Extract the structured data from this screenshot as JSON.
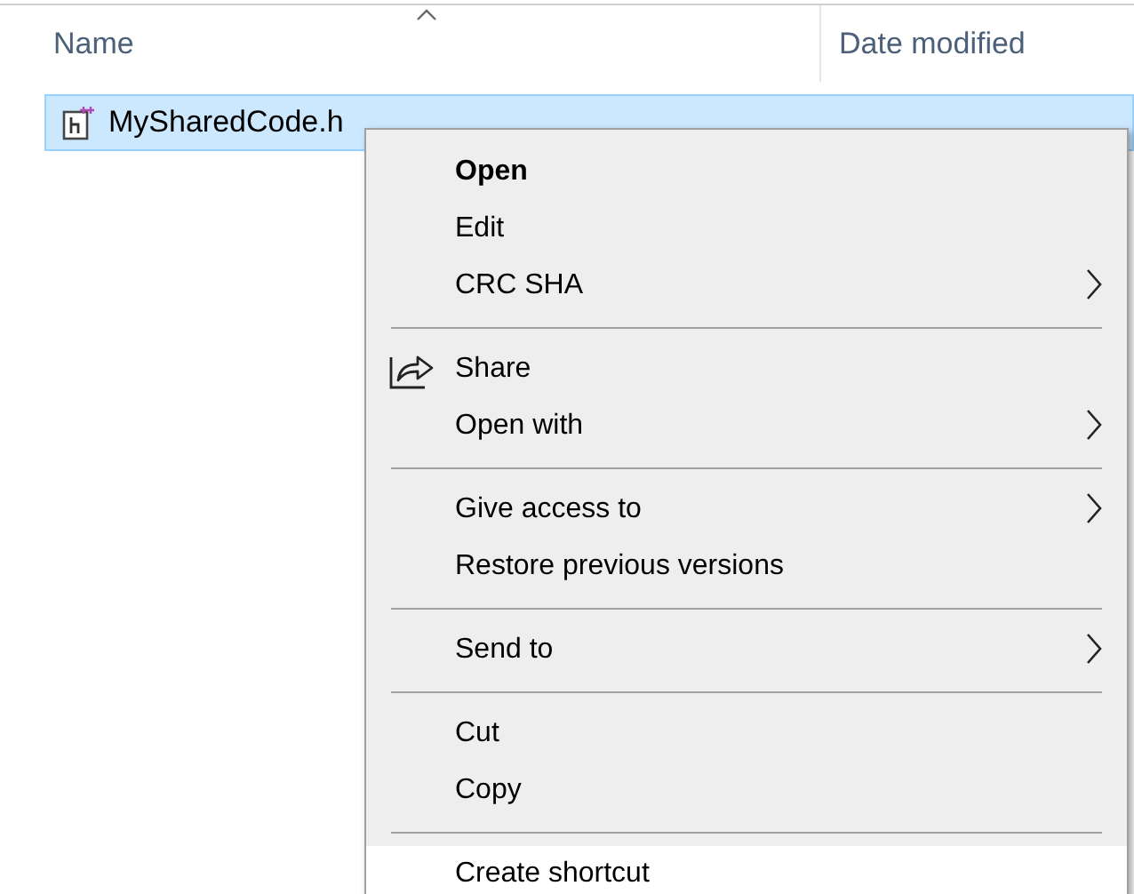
{
  "columns": [
    {
      "label": "Name",
      "sorted": true
    },
    {
      "label": "Date modified",
      "sorted": false
    }
  ],
  "files": [
    {
      "name": "MySharedCode.h",
      "selected": true
    }
  ],
  "context_menu": {
    "items": [
      {
        "kind": "item",
        "label": "Open",
        "default": true,
        "submenu": false,
        "has_icon": false,
        "highlighted": false
      },
      {
        "kind": "item",
        "label": "Edit",
        "default": false,
        "submenu": false,
        "has_icon": false,
        "highlighted": false
      },
      {
        "kind": "item",
        "label": "CRC SHA",
        "default": false,
        "submenu": true,
        "has_icon": false,
        "highlighted": false
      },
      {
        "kind": "separator"
      },
      {
        "kind": "item",
        "label": "Share",
        "default": false,
        "submenu": false,
        "has_icon": true,
        "highlighted": false
      },
      {
        "kind": "item",
        "label": "Open with",
        "default": false,
        "submenu": true,
        "has_icon": false,
        "highlighted": false
      },
      {
        "kind": "separator"
      },
      {
        "kind": "item",
        "label": "Give access to",
        "default": false,
        "submenu": true,
        "has_icon": false,
        "highlighted": false
      },
      {
        "kind": "item",
        "label": "Restore previous versions",
        "default": false,
        "submenu": false,
        "has_icon": false,
        "highlighted": false
      },
      {
        "kind": "separator"
      },
      {
        "kind": "item",
        "label": "Send to",
        "default": false,
        "submenu": true,
        "has_icon": false,
        "highlighted": false
      },
      {
        "kind": "separator"
      },
      {
        "kind": "item",
        "label": "Cut",
        "default": false,
        "submenu": false,
        "has_icon": false,
        "highlighted": false
      },
      {
        "kind": "item",
        "label": "Copy",
        "default": false,
        "submenu": false,
        "has_icon": false,
        "highlighted": false
      },
      {
        "kind": "separator"
      },
      {
        "kind": "item",
        "label": "Create shortcut",
        "default": false,
        "submenu": false,
        "has_icon": false,
        "highlighted": true
      }
    ]
  }
}
